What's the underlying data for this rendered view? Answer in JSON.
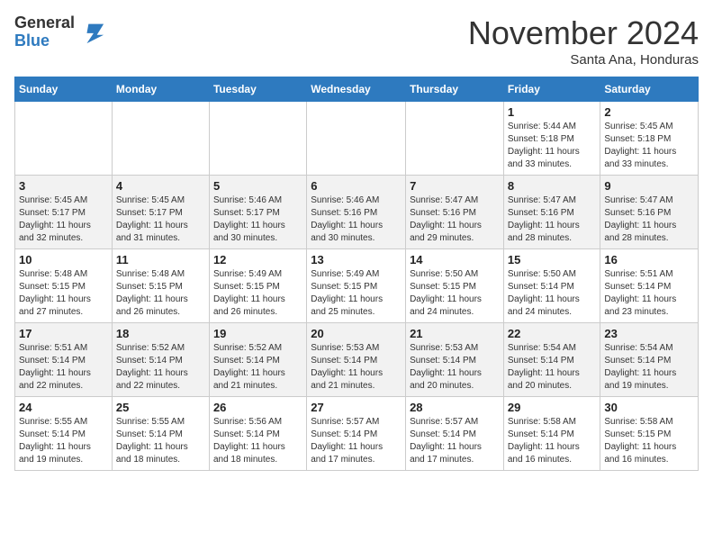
{
  "logo": {
    "general": "General",
    "blue": "Blue"
  },
  "title": "November 2024",
  "location": "Santa Ana, Honduras",
  "days_of_week": [
    "Sunday",
    "Monday",
    "Tuesday",
    "Wednesday",
    "Thursday",
    "Friday",
    "Saturday"
  ],
  "weeks": [
    [
      {
        "day": "",
        "info": ""
      },
      {
        "day": "",
        "info": ""
      },
      {
        "day": "",
        "info": ""
      },
      {
        "day": "",
        "info": ""
      },
      {
        "day": "",
        "info": ""
      },
      {
        "day": "1",
        "info": "Sunrise: 5:44 AM\nSunset: 5:18 PM\nDaylight: 11 hours\nand 33 minutes."
      },
      {
        "day": "2",
        "info": "Sunrise: 5:45 AM\nSunset: 5:18 PM\nDaylight: 11 hours\nand 33 minutes."
      }
    ],
    [
      {
        "day": "3",
        "info": "Sunrise: 5:45 AM\nSunset: 5:17 PM\nDaylight: 11 hours\nand 32 minutes."
      },
      {
        "day": "4",
        "info": "Sunrise: 5:45 AM\nSunset: 5:17 PM\nDaylight: 11 hours\nand 31 minutes."
      },
      {
        "day": "5",
        "info": "Sunrise: 5:46 AM\nSunset: 5:17 PM\nDaylight: 11 hours\nand 30 minutes."
      },
      {
        "day": "6",
        "info": "Sunrise: 5:46 AM\nSunset: 5:16 PM\nDaylight: 11 hours\nand 30 minutes."
      },
      {
        "day": "7",
        "info": "Sunrise: 5:47 AM\nSunset: 5:16 PM\nDaylight: 11 hours\nand 29 minutes."
      },
      {
        "day": "8",
        "info": "Sunrise: 5:47 AM\nSunset: 5:16 PM\nDaylight: 11 hours\nand 28 minutes."
      },
      {
        "day": "9",
        "info": "Sunrise: 5:47 AM\nSunset: 5:16 PM\nDaylight: 11 hours\nand 28 minutes."
      }
    ],
    [
      {
        "day": "10",
        "info": "Sunrise: 5:48 AM\nSunset: 5:15 PM\nDaylight: 11 hours\nand 27 minutes."
      },
      {
        "day": "11",
        "info": "Sunrise: 5:48 AM\nSunset: 5:15 PM\nDaylight: 11 hours\nand 26 minutes."
      },
      {
        "day": "12",
        "info": "Sunrise: 5:49 AM\nSunset: 5:15 PM\nDaylight: 11 hours\nand 26 minutes."
      },
      {
        "day": "13",
        "info": "Sunrise: 5:49 AM\nSunset: 5:15 PM\nDaylight: 11 hours\nand 25 minutes."
      },
      {
        "day": "14",
        "info": "Sunrise: 5:50 AM\nSunset: 5:15 PM\nDaylight: 11 hours\nand 24 minutes."
      },
      {
        "day": "15",
        "info": "Sunrise: 5:50 AM\nSunset: 5:14 PM\nDaylight: 11 hours\nand 24 minutes."
      },
      {
        "day": "16",
        "info": "Sunrise: 5:51 AM\nSunset: 5:14 PM\nDaylight: 11 hours\nand 23 minutes."
      }
    ],
    [
      {
        "day": "17",
        "info": "Sunrise: 5:51 AM\nSunset: 5:14 PM\nDaylight: 11 hours\nand 22 minutes."
      },
      {
        "day": "18",
        "info": "Sunrise: 5:52 AM\nSunset: 5:14 PM\nDaylight: 11 hours\nand 22 minutes."
      },
      {
        "day": "19",
        "info": "Sunrise: 5:52 AM\nSunset: 5:14 PM\nDaylight: 11 hours\nand 21 minutes."
      },
      {
        "day": "20",
        "info": "Sunrise: 5:53 AM\nSunset: 5:14 PM\nDaylight: 11 hours\nand 21 minutes."
      },
      {
        "day": "21",
        "info": "Sunrise: 5:53 AM\nSunset: 5:14 PM\nDaylight: 11 hours\nand 20 minutes."
      },
      {
        "day": "22",
        "info": "Sunrise: 5:54 AM\nSunset: 5:14 PM\nDaylight: 11 hours\nand 20 minutes."
      },
      {
        "day": "23",
        "info": "Sunrise: 5:54 AM\nSunset: 5:14 PM\nDaylight: 11 hours\nand 19 minutes."
      }
    ],
    [
      {
        "day": "24",
        "info": "Sunrise: 5:55 AM\nSunset: 5:14 PM\nDaylight: 11 hours\nand 19 minutes."
      },
      {
        "day": "25",
        "info": "Sunrise: 5:55 AM\nSunset: 5:14 PM\nDaylight: 11 hours\nand 18 minutes."
      },
      {
        "day": "26",
        "info": "Sunrise: 5:56 AM\nSunset: 5:14 PM\nDaylight: 11 hours\nand 18 minutes."
      },
      {
        "day": "27",
        "info": "Sunrise: 5:57 AM\nSunset: 5:14 PM\nDaylight: 11 hours\nand 17 minutes."
      },
      {
        "day": "28",
        "info": "Sunrise: 5:57 AM\nSunset: 5:14 PM\nDaylight: 11 hours\nand 17 minutes."
      },
      {
        "day": "29",
        "info": "Sunrise: 5:58 AM\nSunset: 5:14 PM\nDaylight: 11 hours\nand 16 minutes."
      },
      {
        "day": "30",
        "info": "Sunrise: 5:58 AM\nSunset: 5:15 PM\nDaylight: 11 hours\nand 16 minutes."
      }
    ]
  ]
}
